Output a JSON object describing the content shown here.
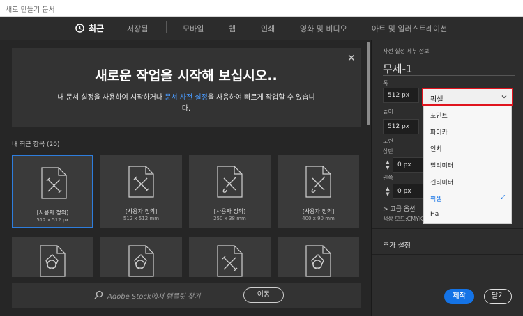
{
  "window": {
    "title": "새로 만들기 문서"
  },
  "tabs": [
    {
      "label": "최근"
    },
    {
      "label": "저장됨"
    },
    {
      "label": "모바일"
    },
    {
      "label": "웹"
    },
    {
      "label": "인쇄"
    },
    {
      "label": "영화 및 비디오"
    },
    {
      "label": "아트 및 일러스트레이션"
    }
  ],
  "hero": {
    "title": "새로운 작업을 시작해 보십시오..",
    "body_before": "내 문서 설정을 사용하여 시작하거나 ",
    "body_link": "문서 사전 설정",
    "body_after": "을 사용하여 빠르게 작업할 수 있습니다.",
    "close": "✕"
  },
  "recent": {
    "label": "내 최근 항목",
    "count": "(20)",
    "items": [
      {
        "name": "[사용자 정의]",
        "size": "512 x 512 px"
      },
      {
        "name": "[사용자 정의]",
        "size": "512 x 512 mm"
      },
      {
        "name": "[사용자 정의]",
        "size": "250 x 38 mm"
      },
      {
        "name": "[사용자 정의]",
        "size": "400 x 90 mm"
      }
    ],
    "row2_icons": [
      "shapes-doc-icon",
      "shapes-doc-icon",
      "pen-doc-icon",
      "shapes-doc-icon"
    ]
  },
  "search": {
    "placeholder": "Adobe Stock에서 템플릿 찾기",
    "go_label": "이동"
  },
  "details": {
    "section_title": "사전 설정 세부 정보",
    "doc_name": "무제-1",
    "width_label": "폭",
    "width_value": "512 px",
    "height_label": "높이",
    "height_value": "512 px",
    "bleed_label": "도련",
    "top_label": "상단",
    "top_value": "0 px",
    "left_label": "왼쪽",
    "left_value": "0 px",
    "advanced_label": "> 고급 옵션",
    "color_mode_label": "색상 모드:CMYK",
    "more_settings": "추가 설정",
    "create_label": "제작",
    "close_label": "닫기"
  },
  "unit_dropdown": {
    "selected": "픽셀",
    "options": [
      "포인트",
      "파이카",
      "인치",
      "밀리미터",
      "센티미터",
      "픽셀",
      "Ha"
    ],
    "selected_index": 5
  },
  "colors": {
    "accent": "#1473e6",
    "highlight": "#e0141e"
  }
}
